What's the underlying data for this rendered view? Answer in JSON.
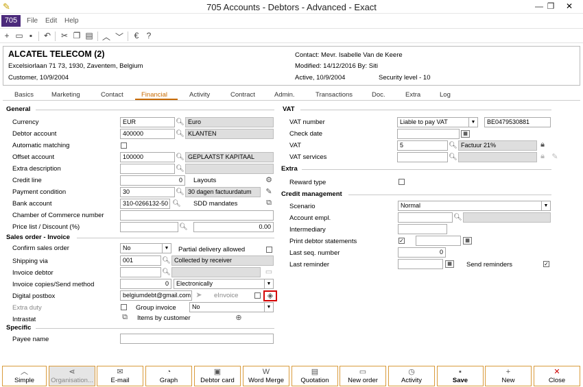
{
  "window": {
    "title": "705 Accounts - Debtors - Advanced - Exact"
  },
  "menubar": {
    "company": "705",
    "items": [
      "File",
      "Edit",
      "Help"
    ]
  },
  "header": {
    "name": "ALCATEL TELECOM (2)",
    "address": "Excelsiorlaan 71 73, 1930, Zaventem, Belgium",
    "customer": "Customer, 10/9/2004",
    "contact": "Contact: Mevr. Isabelle Van de Keere",
    "modified": "Modified: 14/12/2016  By: Siti",
    "active": "Active, 10/9/2004",
    "security": "Security level - 10"
  },
  "tabs": [
    "Basics",
    "Marketing",
    "Contact",
    "Financial",
    "Activity",
    "Contract",
    "Admin.",
    "Transactions",
    "Doc.",
    "Extra",
    "Log"
  ],
  "active_tab": "Financial",
  "general": {
    "title": "General",
    "currency": {
      "label": "Currency",
      "code": "EUR",
      "name": "Euro"
    },
    "debtor_account": {
      "label": "Debtor account",
      "code": "400000",
      "name": "KLANTEN"
    },
    "automatic_matching": {
      "label": "Automatic matching",
      "checked": false
    },
    "offset_account": {
      "label": "Offset account",
      "code": "100000",
      "name": "GEPLAATST KAPITAAL"
    },
    "extra_description": {
      "label": "Extra description",
      "value": ""
    },
    "credit_line": {
      "label": "Credit line",
      "value": "0",
      "layouts_label": "Layouts"
    },
    "payment_condition": {
      "label": "Payment condition",
      "code": "30",
      "name": "30 dagen factuurdatum"
    },
    "bank_account": {
      "label": "Bank account",
      "value": "310-0266132-50",
      "sdd_label": "SDD mandates"
    },
    "chamber": {
      "label": "Chamber of Commerce number",
      "value": ""
    },
    "price_list": {
      "label": "Price list / Discount (%)",
      "value": "",
      "discount": "0.00"
    }
  },
  "sales_order": {
    "title": "Sales order - Invoice",
    "confirm": {
      "label": "Confirm sales order",
      "value": "No"
    },
    "partial_delivery": {
      "label": "Partial delivery allowed",
      "checked": false
    },
    "shipping": {
      "label": "Shipping via",
      "code": "001",
      "name": "Collected by receiver"
    },
    "invoice_debtor": {
      "label": "Invoice debtor",
      "value": ""
    },
    "invoice_copies": {
      "label": "Invoice copies/Send method",
      "value": "0",
      "method": "Electronically"
    },
    "digital_postbox": {
      "label": "Digital postbox",
      "value": "belgiumdebt@gmail.com",
      "einvoice": "eInvoice"
    },
    "extra_duty": {
      "label": "Extra duty",
      "checked": false,
      "group_invoice_label": "Group invoice",
      "group_invoice": "No"
    },
    "intrastat": {
      "label": "Intrastat",
      "items_label": "Items by customer"
    }
  },
  "specific": {
    "title": "Specific",
    "payee": {
      "label": "Payee name",
      "value": ""
    }
  },
  "vat": {
    "title": "VAT",
    "vat_number": {
      "label": "VAT number",
      "type": "Liable to pay VAT",
      "value": "BE0479530881"
    },
    "check_date": {
      "label": "Check date",
      "value": ""
    },
    "vat": {
      "label": "VAT",
      "code": "5",
      "name": "Factuur 21%"
    },
    "vat_services": {
      "label": "VAT services",
      "value": ""
    }
  },
  "extra": {
    "title": "Extra",
    "reward_type": {
      "label": "Reward type",
      "checked": false
    }
  },
  "credit": {
    "title": "Credit management",
    "scenario": {
      "label": "Scenario",
      "value": "Normal"
    },
    "account_empl": {
      "label": "Account empl.",
      "value": ""
    },
    "intermediary": {
      "label": "Intermediary",
      "value": ""
    },
    "print_statements": {
      "label": "Print debtor statements",
      "checked": true
    },
    "last_seq": {
      "label": "Last seq. number",
      "value": "0"
    },
    "last_reminder": {
      "label": "Last reminder",
      "value": ""
    },
    "send_reminders": {
      "label": "Send reminders",
      "checked": true
    }
  },
  "bottom_buttons": [
    {
      "label": "Simple",
      "icon": "chevron-up-icon",
      "glyph": "︿"
    },
    {
      "label": "Organisation...",
      "icon": "share-icon",
      "glyph": "⋖"
    },
    {
      "label": "E-mail",
      "icon": "mail-icon",
      "glyph": "✉"
    },
    {
      "label": "Graph",
      "icon": "graph-icon",
      "glyph": "◔"
    },
    {
      "label": "Debtor card",
      "icon": "card-icon",
      "glyph": "▣"
    },
    {
      "label": "Word Merge",
      "icon": "word-icon",
      "glyph": "W"
    },
    {
      "label": "Quotation",
      "icon": "quotation-icon",
      "glyph": "▤"
    },
    {
      "label": "New order",
      "icon": "new-order-icon",
      "glyph": "▭"
    },
    {
      "label": "Activity",
      "icon": "stopwatch-icon",
      "glyph": "◷"
    },
    {
      "label": "Save",
      "icon": "save-icon",
      "glyph": "▪"
    },
    {
      "label": "New",
      "icon": "plus-icon",
      "glyph": "+"
    },
    {
      "label": "Close",
      "icon": "close-icon",
      "glyph": "✕"
    }
  ]
}
